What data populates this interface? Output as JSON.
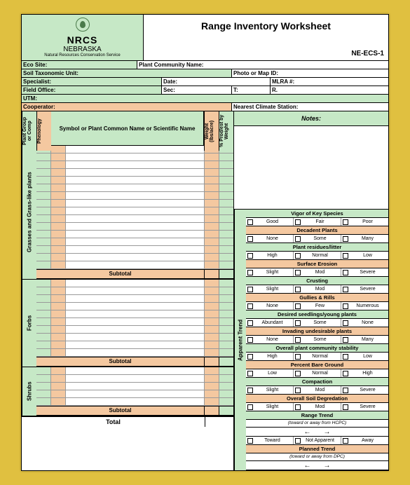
{
  "header": {
    "agency": "NRCS",
    "state": "NEBRASKA",
    "org": "Natural Resources Conservation Service",
    "title": "Range Inventory Worksheet",
    "code": "NE-ECS-1"
  },
  "fields": {
    "eco": "Eco Site:",
    "plant_comm": "Plant Community Name:",
    "soil": "Soil Taxonomic Unit:",
    "photo": "Photo or Map ID:",
    "specialist": "Specialist:",
    "date": "Date:",
    "mlra": "MLRA #:",
    "field_office": "Field Office:",
    "sec": "Sec:",
    "t": "T:",
    "r": "R.",
    "utm": "UTM:",
    "coop": "Cooperator:",
    "nearest": "Nearest Climate Station:"
  },
  "cols": {
    "group": "Plant Group or Comp",
    "phen": "Phenology",
    "name": "Symbol or Plant Common Name or Scientific Name",
    "weight": "Weight (lbs/acre)",
    "pct": "% Prod/est by Weight"
  },
  "sections": {
    "grasses": "Grasses and Grass-like plants",
    "forbs": "Forbs",
    "shrubs": "Shrubs",
    "subtotal": "Subtotal",
    "total": "Total"
  },
  "right": {
    "notes": "Notes:",
    "trend": "Apparent Trend",
    "items": [
      {
        "h": "Vigor of Key Species",
        "o": [
          "Good",
          "Fair",
          "Poor"
        ],
        "c": "green"
      },
      {
        "h": "Decadent Plants",
        "o": [
          "None",
          "Some",
          "Many"
        ],
        "c": "peach"
      },
      {
        "h": "Plant residues/litter",
        "o": [
          "High",
          "Normal",
          "Low"
        ],
        "c": "green"
      },
      {
        "h": "Surface Erosion",
        "o": [
          "Slight",
          "Mod",
          "Severe"
        ],
        "c": "peach"
      },
      {
        "h": "Crusting",
        "o": [
          "Slight",
          "Mod",
          "Severe"
        ],
        "c": "green"
      },
      {
        "h": "Gullies & Rills",
        "o": [
          "None",
          "Few",
          "Numerous"
        ],
        "c": "peach"
      },
      {
        "h": "Desired seedlings/young plants",
        "o": [
          "Abundant",
          "Some",
          "None"
        ],
        "c": "green"
      },
      {
        "h": "Invading undesirable plants",
        "o": [
          "None",
          "Some",
          "Many"
        ],
        "c": "peach"
      },
      {
        "h": "Overall plant community stability",
        "o": [
          "High",
          "Normal",
          "Low"
        ],
        "c": "green"
      },
      {
        "h": "Percent Bare Ground",
        "o": [
          "Low",
          "Normal",
          "High"
        ],
        "c": "peach"
      },
      {
        "h": "Compaction",
        "o": [
          "Slight",
          "Mod",
          "Severe"
        ],
        "c": "green"
      },
      {
        "h": "Overall Soil Degredation",
        "o": [
          "Slight",
          "Mod",
          "Severe"
        ],
        "c": "peach"
      }
    ],
    "range_trend": "Range Trend",
    "range_sub": "(toward or away from HCPC)",
    "na": "Not Apparent",
    "planned": "Planned Trend",
    "planned_sub": "(toward or away from DPC)"
  }
}
